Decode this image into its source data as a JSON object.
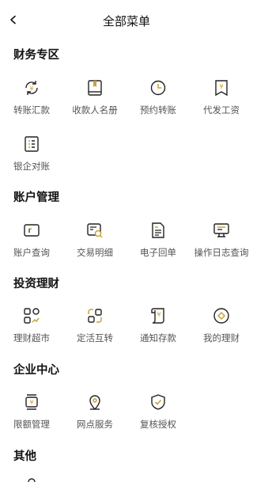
{
  "header": {
    "title": "全部菜单"
  },
  "sections": [
    {
      "title": "财务专区",
      "items": [
        {
          "label": "转账汇款",
          "icon": "transfer-icon"
        },
        {
          "label": "收款人名册",
          "icon": "payee-book-icon"
        },
        {
          "label": "预约转账",
          "icon": "scheduled-clock-icon"
        },
        {
          "label": "代发工资",
          "icon": "salary-icon"
        },
        {
          "label": "银企对账",
          "icon": "reconcile-icon"
        }
      ]
    },
    {
      "title": "账户管理",
      "items": [
        {
          "label": "账户查询",
          "icon": "wallet-icon"
        },
        {
          "label": "交易明细",
          "icon": "transaction-search-icon"
        },
        {
          "label": "电子回单",
          "icon": "receipt-icon"
        },
        {
          "label": "操作日志查询",
          "icon": "log-icon"
        }
      ]
    },
    {
      "title": "投资理财",
      "items": [
        {
          "label": "理财超市",
          "icon": "market-grid-icon"
        },
        {
          "label": "定活互转",
          "icon": "swap-icon"
        },
        {
          "label": "通知存款",
          "icon": "notice-deposit-icon"
        },
        {
          "label": "我的理财",
          "icon": "my-wealth-icon"
        }
      ]
    },
    {
      "title": "企业中心",
      "items": [
        {
          "label": "限额管理",
          "icon": "limit-icon"
        },
        {
          "label": "网点服务",
          "icon": "location-pin-icon"
        },
        {
          "label": "复核授权",
          "icon": "shield-check-icon"
        }
      ]
    },
    {
      "title": "其他",
      "items": []
    }
  ],
  "colors": {
    "accent": "#c9a235",
    "stroke": "#222222"
  }
}
